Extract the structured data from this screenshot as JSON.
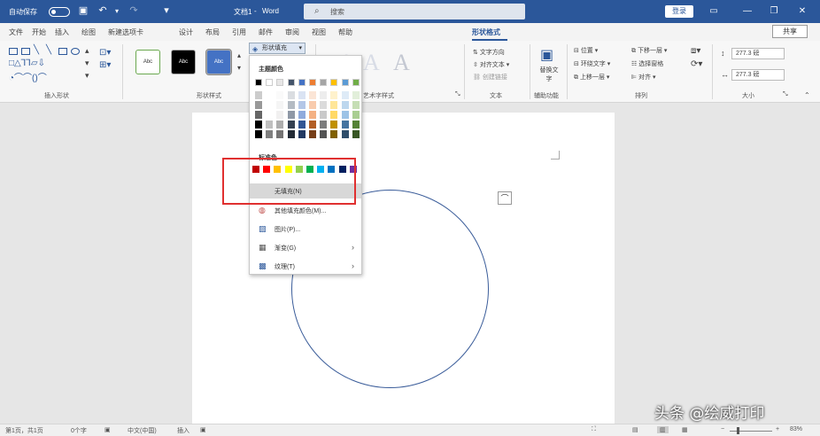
{
  "titlebar": {
    "autosave_label": "自动保存",
    "doc_title": "文档1",
    "app_name": "Word",
    "search_placeholder": "搜索",
    "login_label": "登录"
  },
  "tabs": [
    "文件",
    "开始",
    "插入",
    "绘图",
    "新建选项卡",
    "设计",
    "布局",
    "引用",
    "邮件",
    "审阅",
    "视图",
    "帮助",
    "形状格式"
  ],
  "active_tab": "形状格式",
  "share_label": "共享",
  "ribbon": {
    "groups": {
      "insert_shapes": "插入形状",
      "shape_styles": "形状样式",
      "wordart_styles": "艺术字样式",
      "text": "文本",
      "accessibility": "辅助功能",
      "arrange": "排列",
      "size": "大小"
    },
    "style_presets": [
      "Abc",
      "Abc",
      "Abc"
    ],
    "shape_fill_button": "形状填充",
    "text_items": [
      "文字方向",
      "对齐文本",
      "创建链接"
    ],
    "alt_text": "替换文字",
    "arrange_items": [
      "位置",
      "环绕文字",
      "上移一层",
      "下移一层",
      "选择窗格",
      "对齐"
    ],
    "height_value": "277.3 磅",
    "width_value": "277.3 磅",
    "wordart_letters": [
      "A",
      "A",
      "A"
    ]
  },
  "fill_menu": {
    "theme_colors_label": "主题颜色",
    "standard_colors_label": "标准色",
    "no_fill": "无填充(N)",
    "more_colors": "其他填充颜色(M)...",
    "picture": "图片(P)...",
    "gradient": "渐变(G)",
    "texture": "纹理(T)",
    "theme_top_row": [
      "#000000",
      "#ffffff",
      "#e7e6e6",
      "#44546a",
      "#4472c4",
      "#ed7d31",
      "#a5a5a5",
      "#ffc000",
      "#5b9bd5",
      "#70ad47"
    ],
    "standard_colors": [
      "#c00000",
      "#ff0000",
      "#ffc000",
      "#ffff00",
      "#92d050",
      "#00b050",
      "#00b0f0",
      "#0070c0",
      "#002060",
      "#7030a0"
    ]
  },
  "statusbar": {
    "page": "第1页，共1页",
    "words": "0个字",
    "language": "中文(中国)",
    "mode": "插入",
    "zoom": "83%"
  },
  "watermark": "头条 @绘威打印",
  "colors": {
    "accent": "#2b579a",
    "highlight_box": "#e03030",
    "shape_outline": "#3b5d9a"
  }
}
